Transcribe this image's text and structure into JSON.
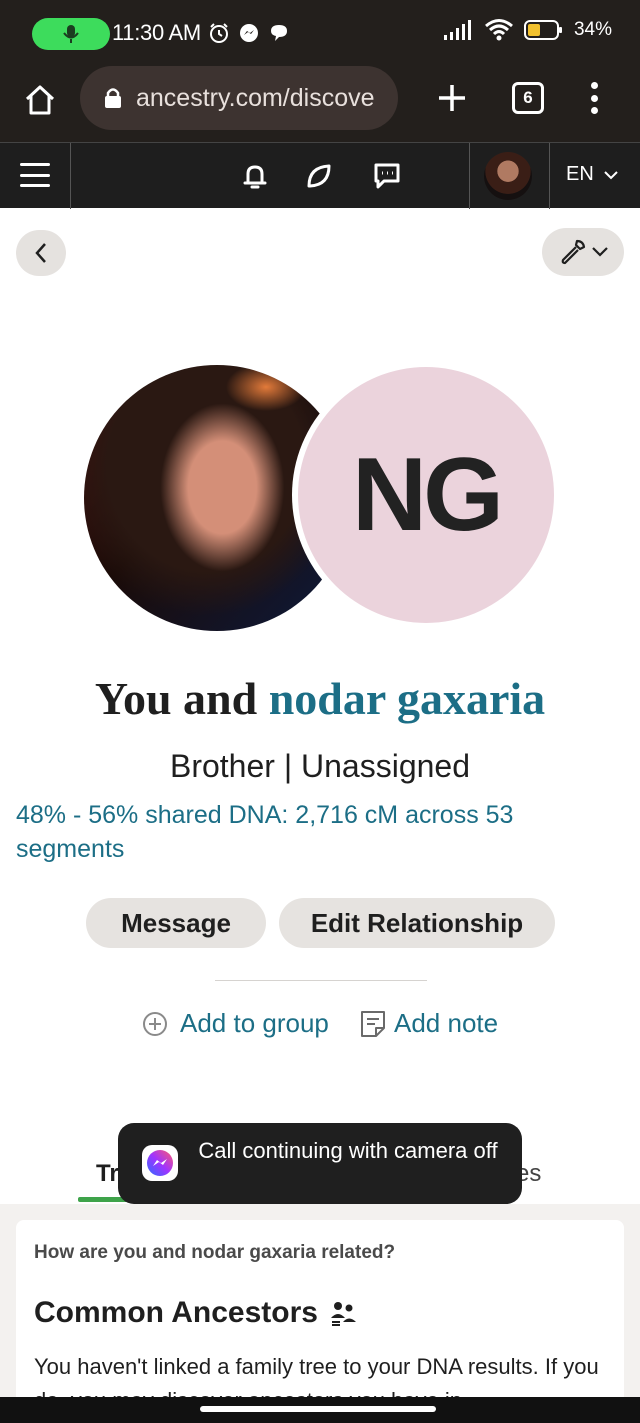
{
  "status_bar": {
    "time": "11:30 AM",
    "battery": "34%",
    "icons": [
      "mic-icon",
      "alarm-icon",
      "messenger-icon",
      "chat-bubble-icon",
      "signal-icon",
      "wifi-icon",
      "battery-icon"
    ]
  },
  "browser": {
    "url": "ancestry.com/discove",
    "tab_count": "6"
  },
  "site_nav": {
    "language": "EN",
    "icons": [
      "hamburger-menu-icon",
      "bell-icon",
      "leaf-hint-icon",
      "message-icon",
      "user-avatar",
      "chevron-down-icon"
    ]
  },
  "match": {
    "initials": "NG",
    "title_prefix": "You and",
    "name": "nodar gaxaria",
    "relationship": "Brother | Unassigned",
    "dna_summary": "48% - 56% shared DNA: 2,716 cM across 53 segments"
  },
  "actions": {
    "message": "Message",
    "edit_relationship": "Edit Relationship",
    "add_to_group": "Add to group",
    "add_note": "Add note"
  },
  "tabs": {
    "left_fragment": "Tr",
    "right_fragment": "es"
  },
  "toast": {
    "text": "Call continuing with camera off"
  },
  "related": {
    "question": "How are you and nodar gaxaria related?",
    "heading": "Common Ancestors",
    "body": "You haven't linked a family tree to your DNA results. If you do, you may discover ancestors you have in"
  },
  "colors": {
    "link": "#1c6e86",
    "initials_bg": "#ebd3dc",
    "tab_accent": "#3ea34a",
    "mic_pill": "#3ddc5c"
  }
}
